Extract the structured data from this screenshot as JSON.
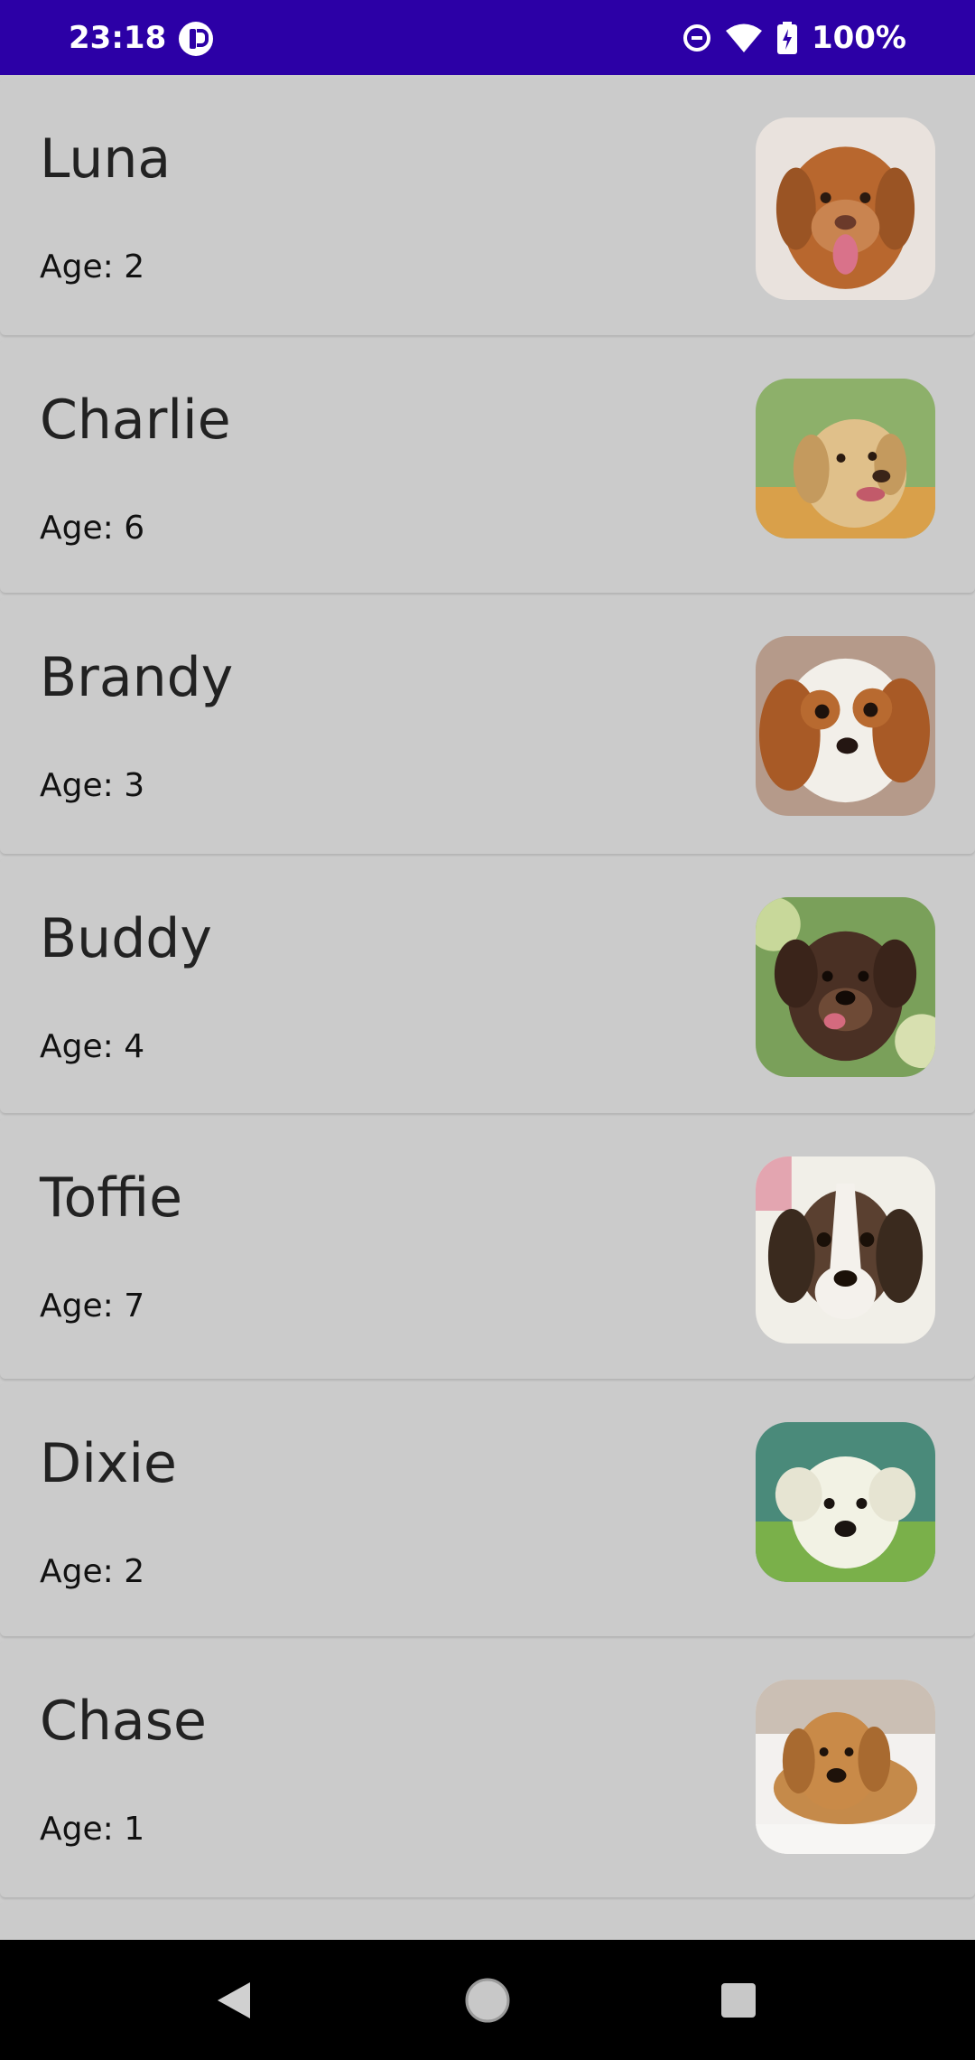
{
  "status_bar": {
    "time": "23:18",
    "battery_text": "100%",
    "background_color": "#2c00a6",
    "icons": [
      "app-badge-icon",
      "do-not-disturb-icon",
      "wifi-icon",
      "battery-charging-icon"
    ]
  },
  "dogs": [
    {
      "name": "Luna",
      "age": "Age: 2"
    },
    {
      "name": "Charlie",
      "age": "Age: 6"
    },
    {
      "name": "Brandy",
      "age": "Age: 3"
    },
    {
      "name": "Buddy",
      "age": "Age: 4"
    },
    {
      "name": "Toffie",
      "age": "Age: 7"
    },
    {
      "name": "Dixie",
      "age": "Age: 2"
    },
    {
      "name": "Chase",
      "age": "Age: 1"
    }
  ],
  "nav_bar": {
    "icons": [
      "back-icon",
      "home-icon",
      "recents-icon"
    ]
  }
}
